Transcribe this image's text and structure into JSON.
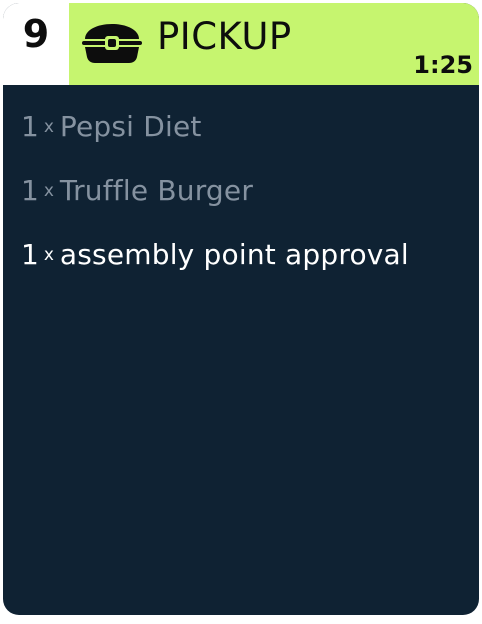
{
  "ticket": {
    "order_number": "9",
    "order_type": "PICKUP",
    "order_type_icon": "takeout-box-icon",
    "timer": "1:25",
    "colors": {
      "header_accent": "#c6f56f",
      "body_background": "#0f2233",
      "item_done": "#8592a0",
      "item_active": "#ffffff"
    },
    "items": [
      {
        "qty": "1",
        "separator": "x",
        "name": "Pepsi Diet",
        "state": "done"
      },
      {
        "qty": "1",
        "separator": "x",
        "name": "Truffle Burger",
        "state": "done"
      },
      {
        "qty": "1",
        "separator": "x",
        "name": "assembly point approval",
        "state": "active"
      }
    ]
  }
}
